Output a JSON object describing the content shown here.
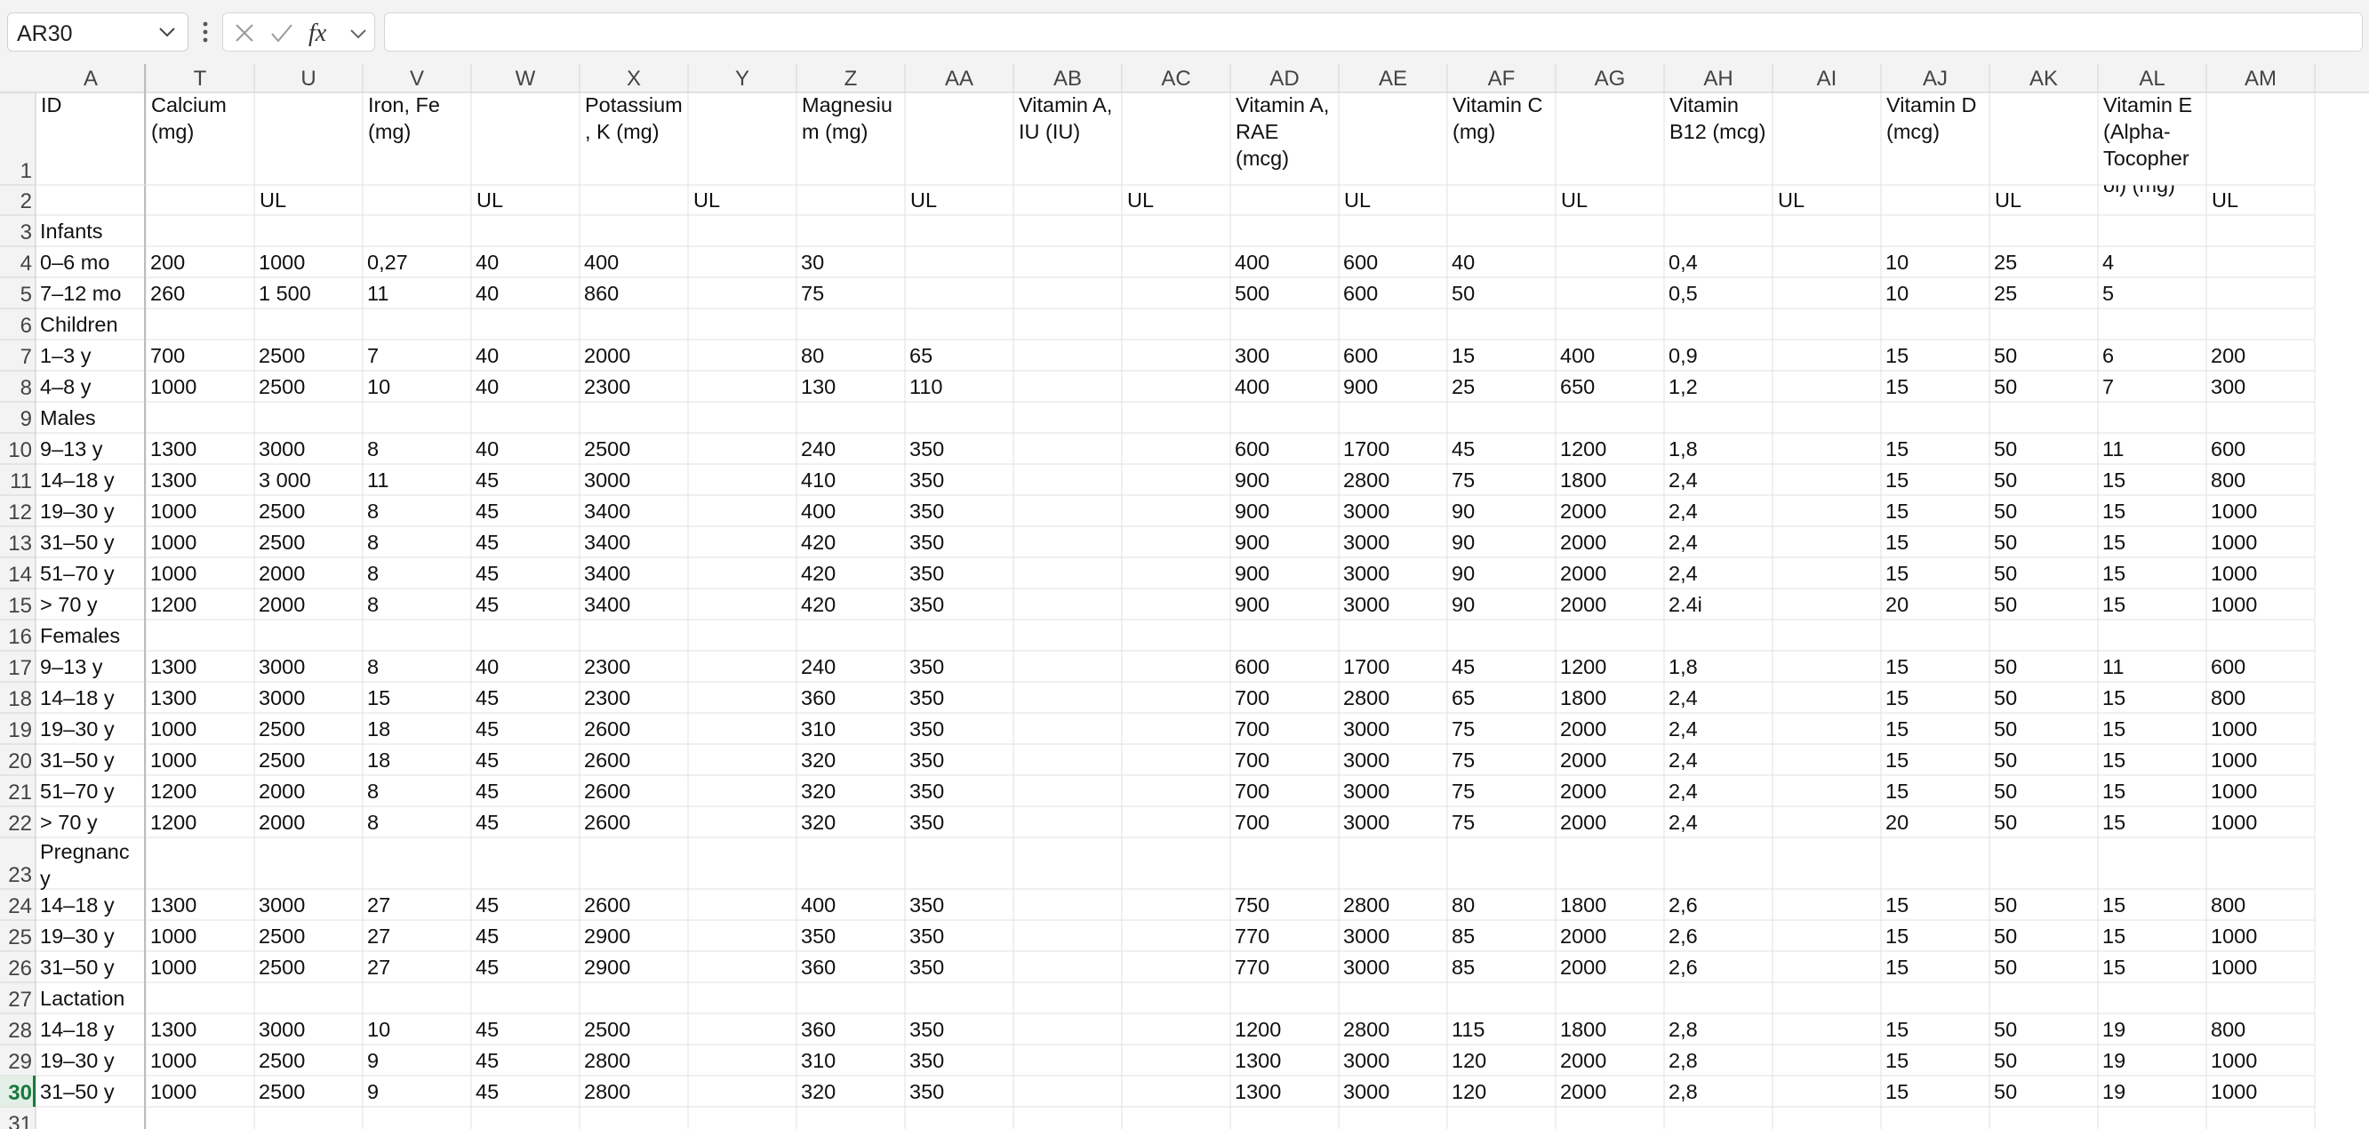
{
  "app": {
    "selected_cell": "AR30",
    "formula": ""
  },
  "icons": {
    "name_box": "chevron-down-icon",
    "menu": "vertical-dots-icon",
    "cancel": "x-icon",
    "enter": "check-icon",
    "function": "fx-icon",
    "function_menu": "chevron-down-icon"
  },
  "labels": {
    "fx": "fx"
  },
  "colors": {
    "grid": "#e1e1e1",
    "header_bg": "#f3f3f3",
    "selection_accent": "#1a7a3e"
  },
  "columns": [
    "A",
    "T",
    "U",
    "V",
    "W",
    "X",
    "Y",
    "Z",
    "AA",
    "AB",
    "AC",
    "AD",
    "AE",
    "AF",
    "AG",
    "AH",
    "AI",
    "AJ",
    "AK",
    "AL",
    "AM"
  ],
  "row_numbers": [
    "1",
    "2",
    "3",
    "4",
    "5",
    "6",
    "7",
    "8",
    "9",
    "10",
    "11",
    "12",
    "13",
    "14",
    "15",
    "16",
    "17",
    "18",
    "19",
    "20",
    "21",
    "22",
    "23",
    "24",
    "25",
    "26",
    "27",
    "28",
    "29",
    "30",
    "31"
  ],
  "header_row": {
    "A": [
      "ID"
    ],
    "T": [
      "Calcium",
      "(mg)"
    ],
    "V": [
      "Iron, Fe",
      "(mg)"
    ],
    "X": [
      "Potassium",
      ", K (mg)"
    ],
    "Z": [
      "Magnesiu",
      "m (mg)"
    ],
    "AB": [
      "Vitamin A,",
      "IU (IU)"
    ],
    "AD": [
      "Vitamin A,",
      "RAE",
      "(mcg)"
    ],
    "AF": [
      "Vitamin C",
      "(mg)"
    ],
    "AH": [
      "Vitamin",
      "B12 (mcg)"
    ],
    "AJ": [
      "Vitamin D",
      "(mcg)"
    ],
    "AL": [
      "Vitamin E",
      "(Alpha-",
      "Tocopher",
      "ol) (mg)"
    ]
  },
  "ul_label": "UL",
  "ul_columns": [
    "U",
    "W",
    "Y",
    "AA",
    "AC",
    "AE",
    "AG",
    "AI",
    "AK",
    "AM"
  ],
  "rows": [
    {
      "r": "3",
      "cells": {
        "A": "Infants"
      }
    },
    {
      "r": "4",
      "cells": {
        "A": "0–6 mo",
        "T": "200",
        "U": "1000",
        "V": "0,27",
        "W": "40",
        "X": "400",
        "Z": "30",
        "AD": "400",
        "AE": "600",
        "AF": "40",
        "AH": "0,4",
        "AJ": "10",
        "AK": "25",
        "AL": "4"
      }
    },
    {
      "r": "5",
      "cells": {
        "A": "7–12 mo",
        "T": "260",
        "U": "1 500",
        "V": "11",
        "W": "40",
        "X": "860",
        "Z": "75",
        "AD": "500",
        "AE": "600",
        "AF": "50",
        "AH": "0,5",
        "AJ": "10",
        "AK": "25",
        "AL": "5"
      }
    },
    {
      "r": "6",
      "cells": {
        "A": "Children"
      }
    },
    {
      "r": "7",
      "cells": {
        "A": "1–3 y",
        "T": "700",
        "U": "2500",
        "V": "7",
        "W": "40",
        "X": "2000",
        "Z": "80",
        "AA": "65",
        "AD": "300",
        "AE": "600",
        "AF": "15",
        "AG": "400",
        "AH": "0,9",
        "AJ": "15",
        "AK": "50",
        "AL": "6",
        "AM": "200"
      }
    },
    {
      "r": "8",
      "cells": {
        "A": "4–8 y",
        "T": "1000",
        "U": "2500",
        "V": "10",
        "W": "40",
        "X": "2300",
        "Z": "130",
        "AA": "110",
        "AD": "400",
        "AE": "900",
        "AF": "25",
        "AG": "650",
        "AH": "1,2",
        "AJ": "15",
        "AK": "50",
        "AL": "7",
        "AM": "300"
      }
    },
    {
      "r": "9",
      "cells": {
        "A": "Males"
      }
    },
    {
      "r": "10",
      "cells": {
        "A": "9–13 y",
        "T": "1300",
        "U": "3000",
        "V": "8",
        "W": "40",
        "X": "2500",
        "Z": "240",
        "AA": "350",
        "AD": "600",
        "AE": "1700",
        "AF": "45",
        "AG": "1200",
        "AH": "1,8",
        "AJ": "15",
        "AK": "50",
        "AL": "11",
        "AM": "600"
      }
    },
    {
      "r": "11",
      "cells": {
        "A": "14–18 y",
        "T": "1300",
        "U": "3 000",
        "V": "11",
        "W": "45",
        "X": "3000",
        "Z": "410",
        "AA": "350",
        "AD": "900",
        "AE": "2800",
        "AF": "75",
        "AG": "1800",
        "AH": "2,4",
        "AJ": "15",
        "AK": "50",
        "AL": "15",
        "AM": "800"
      }
    },
    {
      "r": "12",
      "cells": {
        "A": "19–30 y",
        "T": "1000",
        "U": "2500",
        "V": "8",
        "W": "45",
        "X": "3400",
        "Z": "400",
        "AA": "350",
        "AD": "900",
        "AE": "3000",
        "AF": "90",
        "AG": "2000",
        "AH": "2,4",
        "AJ": "15",
        "AK": "50",
        "AL": "15",
        "AM": "1000"
      }
    },
    {
      "r": "13",
      "cells": {
        "A": "31–50 y",
        "T": "1000",
        "U": "2500",
        "V": "8",
        "W": "45",
        "X": "3400",
        "Z": "420",
        "AA": "350",
        "AD": "900",
        "AE": "3000",
        "AF": "90",
        "AG": "2000",
        "AH": "2,4",
        "AJ": "15",
        "AK": "50",
        "AL": "15",
        "AM": "1000"
      }
    },
    {
      "r": "14",
      "cells": {
        "A": "51–70 y",
        "T": "1000",
        "U": "2000",
        "V": "8",
        "W": "45",
        "X": "3400",
        "Z": "420",
        "AA": "350",
        "AD": "900",
        "AE": "3000",
        "AF": "90",
        "AG": "2000",
        "AH": "2,4",
        "AJ": "15",
        "AK": "50",
        "AL": "15",
        "AM": "1000"
      }
    },
    {
      "r": "15",
      "cells": {
        "A": "> 70 y",
        "T": "1200",
        "U": "2000",
        "V": "8",
        "W": "45",
        "X": "3400",
        "Z": "420",
        "AA": "350",
        "AD": "900",
        "AE": "3000",
        "AF": "90",
        "AG": "2000",
        "AH": "2.4i",
        "AJ": "20",
        "AK": "50",
        "AL": "15",
        "AM": "1000"
      }
    },
    {
      "r": "16",
      "cells": {
        "A": "Females"
      }
    },
    {
      "r": "17",
      "cells": {
        "A": "9–13 y",
        "T": "1300",
        "U": "3000",
        "V": "8",
        "W": "40",
        "X": "2300",
        "Z": "240",
        "AA": "350",
        "AD": "600",
        "AE": "1700",
        "AF": "45",
        "AG": "1200",
        "AH": "1,8",
        "AJ": "15",
        "AK": "50",
        "AL": "11",
        "AM": "600"
      }
    },
    {
      "r": "18",
      "cells": {
        "A": "14–18 y",
        "T": "1300",
        "U": "3000",
        "V": "15",
        "W": "45",
        "X": "2300",
        "Z": "360",
        "AA": "350",
        "AD": "700",
        "AE": "2800",
        "AF": "65",
        "AG": "1800",
        "AH": "2,4",
        "AJ": "15",
        "AK": "50",
        "AL": "15",
        "AM": "800"
      }
    },
    {
      "r": "19",
      "cells": {
        "A": "19–30 y",
        "T": "1000",
        "U": "2500",
        "V": "18",
        "W": "45",
        "X": "2600",
        "Z": "310",
        "AA": "350",
        "AD": "700",
        "AE": "3000",
        "AF": "75",
        "AG": "2000",
        "AH": "2,4",
        "AJ": "15",
        "AK": "50",
        "AL": "15",
        "AM": "1000"
      }
    },
    {
      "r": "20",
      "cells": {
        "A": "31–50 y",
        "T": "1000",
        "U": "2500",
        "V": "18",
        "W": "45",
        "X": "2600",
        "Z": "320",
        "AA": "350",
        "AD": "700",
        "AE": "3000",
        "AF": "75",
        "AG": "2000",
        "AH": "2,4",
        "AJ": "15",
        "AK": "50",
        "AL": "15",
        "AM": "1000"
      }
    },
    {
      "r": "21",
      "cells": {
        "A": "51–70 y",
        "T": "1200",
        "U": "2000",
        "V": "8",
        "W": "45",
        "X": "2600",
        "Z": "320",
        "AA": "350",
        "AD": "700",
        "AE": "3000",
        "AF": "75",
        "AG": "2000",
        "AH": "2,4",
        "AJ": "15",
        "AK": "50",
        "AL": "15",
        "AM": "1000"
      }
    },
    {
      "r": "22",
      "cells": {
        "A": "> 70 y",
        "T": "1200",
        "U": "2000",
        "V": "8",
        "W": "45",
        "X": "2600",
        "Z": "320",
        "AA": "350",
        "AD": "700",
        "AE": "3000",
        "AF": "75",
        "AG": "2000",
        "AH": "2,4",
        "AJ": "20",
        "AK": "50",
        "AL": "15",
        "AM": "1000"
      }
    },
    {
      "r": "23",
      "cells": {
        "A": "Pregnanc\ny"
      }
    },
    {
      "r": "24",
      "cells": {
        "A": "14–18 y",
        "T": "1300",
        "U": "3000",
        "V": "27",
        "W": "45",
        "X": "2600",
        "Z": "400",
        "AA": "350",
        "AD": "750",
        "AE": "2800",
        "AF": "80",
        "AG": "1800",
        "AH": "2,6",
        "AJ": "15",
        "AK": "50",
        "AL": "15",
        "AM": "800"
      }
    },
    {
      "r": "25",
      "cells": {
        "A": "19–30 y",
        "T": "1000",
        "U": "2500",
        "V": "27",
        "W": "45",
        "X": "2900",
        "Z": "350",
        "AA": "350",
        "AD": "770",
        "AE": "3000",
        "AF": "85",
        "AG": "2000",
        "AH": "2,6",
        "AJ": "15",
        "AK": "50",
        "AL": "15",
        "AM": "1000"
      }
    },
    {
      "r": "26",
      "cells": {
        "A": "31–50 y",
        "T": "1000",
        "U": "2500",
        "V": "27",
        "W": "45",
        "X": "2900",
        "Z": "360",
        "AA": "350",
        "AD": "770",
        "AE": "3000",
        "AF": "85",
        "AG": "2000",
        "AH": "2,6",
        "AJ": "15",
        "AK": "50",
        "AL": "15",
        "AM": "1000"
      }
    },
    {
      "r": "27",
      "cells": {
        "A": "Lactation"
      }
    },
    {
      "r": "28",
      "cells": {
        "A": "14–18 y",
        "T": "1300",
        "U": "3000",
        "V": "10",
        "W": "45",
        "X": "2500",
        "Z": "360",
        "AA": "350",
        "AD": "1200",
        "AE": "2800",
        "AF": "115",
        "AG": "1800",
        "AH": "2,8",
        "AJ": "15",
        "AK": "50",
        "AL": "19",
        "AM": "800"
      }
    },
    {
      "r": "29",
      "cells": {
        "A": "19–30 y",
        "T": "1000",
        "U": "2500",
        "V": "9",
        "W": "45",
        "X": "2800",
        "Z": "310",
        "AA": "350",
        "AD": "1300",
        "AE": "3000",
        "AF": "120",
        "AG": "2000",
        "AH": "2,8",
        "AJ": "15",
        "AK": "50",
        "AL": "19",
        "AM": "1000"
      }
    },
    {
      "r": "30",
      "cells": {
        "A": "31–50 y",
        "T": "1000",
        "U": "2500",
        "V": "9",
        "W": "45",
        "X": "2800",
        "Z": "320",
        "AA": "350",
        "AD": "1300",
        "AE": "3000",
        "AF": "120",
        "AG": "2000",
        "AH": "2,8",
        "AJ": "15",
        "AK": "50",
        "AL": "19",
        "AM": "1000"
      }
    },
    {
      "r": "31",
      "cells": {}
    }
  ]
}
